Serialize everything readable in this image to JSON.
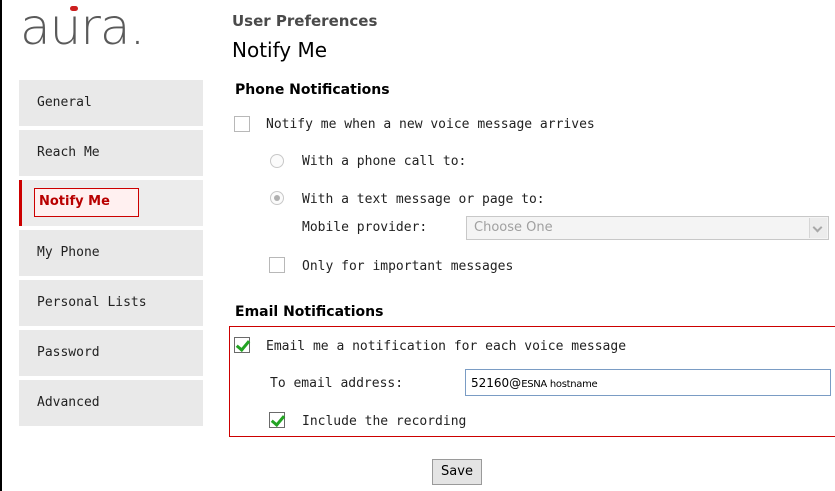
{
  "logo": {
    "text": "aura."
  },
  "sidebar": {
    "items": [
      {
        "label": "General",
        "active": false
      },
      {
        "label": "Reach Me",
        "active": false
      },
      {
        "label": "Notify Me",
        "active": true
      },
      {
        "label": "My Phone",
        "active": false
      },
      {
        "label": "Personal Lists",
        "active": false
      },
      {
        "label": "Password",
        "active": false
      },
      {
        "label": "Advanced",
        "active": false
      }
    ]
  },
  "header": {
    "subtitle": "User Preferences",
    "title": "Notify Me"
  },
  "phone": {
    "section_title": "Phone Notifications",
    "notify_label": "Notify me when a new voice message arrives",
    "notify_checked": false,
    "phone_call_label": "With a phone call to:",
    "text_message_label": "With a text message or page to:",
    "text_message_selected": true,
    "provider_label": "Mobile provider:",
    "provider_value": "Choose One",
    "important_label": "Only for important messages",
    "important_checked": false
  },
  "email": {
    "section_title": "Email Notifications",
    "email_me_label": "Email me a notification for each voice message",
    "email_me_checked": true,
    "address_label": "To email address:",
    "address_value_main": "52160@",
    "address_value_host": "ESNA hostname",
    "include_label": "Include the recording",
    "include_checked": true
  },
  "save_label": "Save",
  "colors": {
    "accent_red": "#cc0000",
    "check_green": "#23a323",
    "nav_bg": "#e9e9e9"
  }
}
